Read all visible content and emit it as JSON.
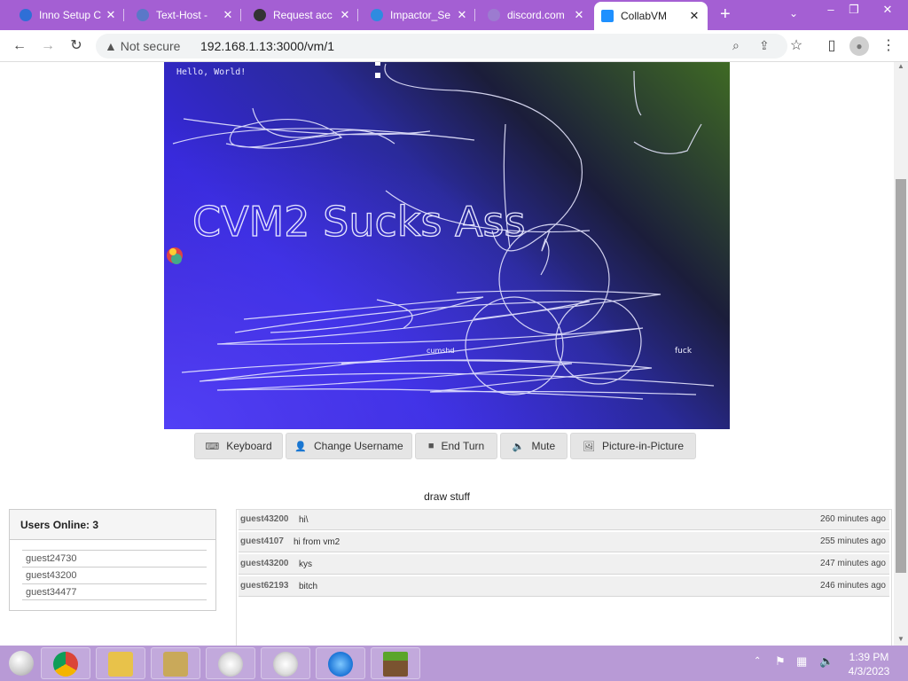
{
  "browser": {
    "tabs": [
      {
        "title": "Inno Setup C",
        "favicon_color": "#2f6fd6"
      },
      {
        "title": "Text-Host - ",
        "favicon_color": "#5a78c8"
      },
      {
        "title": "Request acc",
        "favicon_color": "#333333"
      },
      {
        "title": "Impactor_Se",
        "favicon_color": "#2f8be0"
      },
      {
        "title": "discord.com",
        "favicon_color": "#9c7bd0"
      },
      {
        "title": "CollabVM",
        "favicon_color": "#1e90ff",
        "active": true
      }
    ],
    "new_tab": "+",
    "security_label": "Not secure",
    "url": "192.168.1.13:3000/vm/1",
    "accent_color": "#a45fd3"
  },
  "vm": {
    "screen_text": "Hello, World!",
    "scribble_texts": [
      {
        "text": "CVM2 Sucks Ass"
      },
      {
        "text": "fuck"
      },
      {
        "text": "cumshd"
      }
    ],
    "buttons": [
      {
        "label": "Keyboard",
        "icon": "keyboard-icon",
        "glyph": "⌨"
      },
      {
        "label": "Change Username",
        "icon": "user-icon",
        "glyph": "👤"
      },
      {
        "label": "End Turn",
        "icon": "stop-icon",
        "glyph": "■"
      },
      {
        "label": "Mute",
        "icon": "speaker-icon",
        "glyph": "🔈"
      },
      {
        "label": "Picture-in-Picture",
        "icon": "picture-icon",
        "glyph": "🖼"
      }
    ],
    "title": "draw stuff"
  },
  "users": {
    "heading": "Users Online: 3",
    "list": [
      "guest24730",
      "guest43200",
      "guest34477"
    ]
  },
  "chat": {
    "messages": [
      {
        "user": "guest43200",
        "text": "hi\\",
        "time": "260 minutes ago"
      },
      {
        "user": "guest4107",
        "text": "hi from vm2",
        "time": "255 minutes ago"
      },
      {
        "user": "guest43200",
        "text": "kys",
        "time": "247 minutes ago"
      },
      {
        "user": "guest62193",
        "text": "bitch",
        "time": "246 minutes ago"
      }
    ]
  },
  "taskbar": {
    "items": [
      "chrome-icon",
      "folder-icon",
      "installer-icon",
      "safari-icon",
      "safari-icon",
      "ie-icon",
      "minecraft-icon"
    ],
    "time": "1:39 PM",
    "date": "4/3/2023"
  }
}
